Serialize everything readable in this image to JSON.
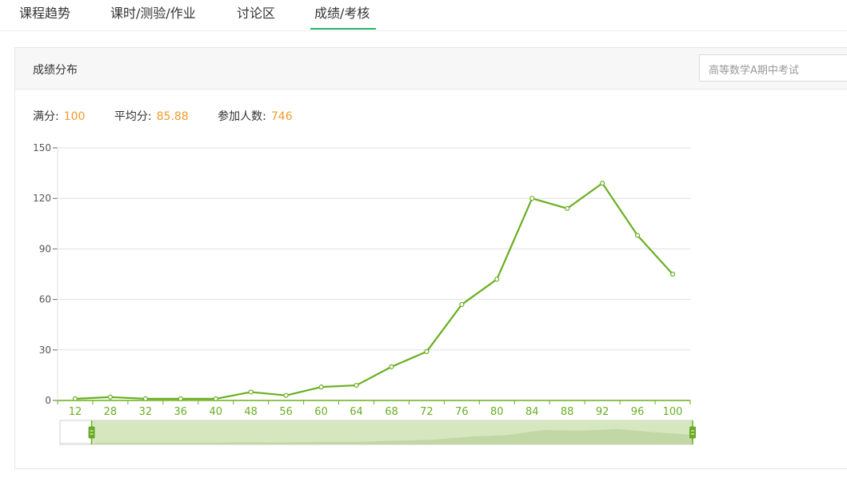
{
  "tabs": [
    {
      "label": "课程趋势"
    },
    {
      "label": "课时/测验/作业"
    },
    {
      "label": "讨论区"
    },
    {
      "label": "成绩/考核"
    }
  ],
  "active_tab": 3,
  "panel": {
    "title": "成绩分布",
    "exam_select": {
      "value": "高等数学A期中考试"
    }
  },
  "stats": {
    "full_score_label": "满分:",
    "full_score": "100",
    "average_label": "平均分:",
    "average": "85.88",
    "participants_label": "参加人数:",
    "participants": "746"
  },
  "colors": {
    "line": "#6aaf22",
    "accent_value": "#f39a2a",
    "tab_underline": "#25b36a",
    "zoom_fill": "#cfe3b5"
  },
  "chart_data": {
    "type": "line",
    "categories": [
      "12",
      "28",
      "32",
      "36",
      "40",
      "48",
      "56",
      "60",
      "64",
      "68",
      "72",
      "76",
      "80",
      "84",
      "88",
      "92",
      "96",
      "100"
    ],
    "values": [
      1,
      2,
      1,
      1,
      1,
      5,
      3,
      8,
      9,
      20,
      29,
      57,
      72,
      120,
      114,
      129,
      98,
      75
    ],
    "y_ticks": [
      0,
      30,
      60,
      90,
      120,
      150
    ],
    "ylim": [
      0,
      150
    ],
    "grid": true,
    "datazoom": {
      "range": [
        0.05,
        1.0
      ]
    }
  }
}
